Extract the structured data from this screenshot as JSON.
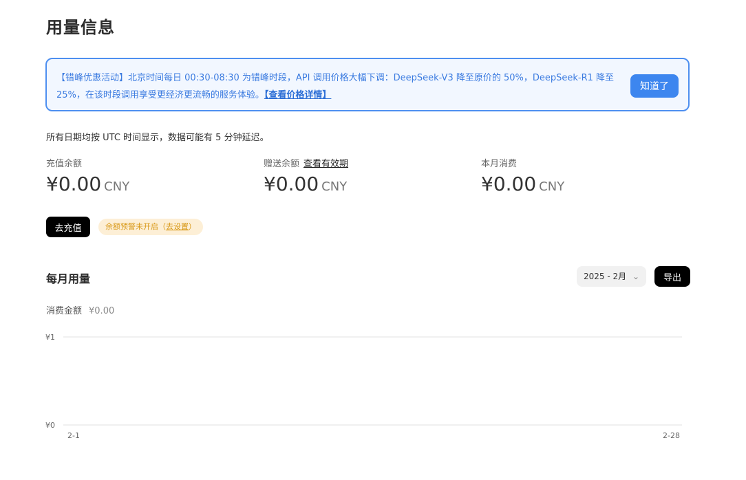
{
  "page": {
    "title": "用量信息"
  },
  "banner": {
    "text": "【错峰优惠活动】北京时间每日 00:30-08:30 为错峰时段，API 调用价格大幅下调：DeepSeek-V3 降至原价的 50%，DeepSeek-R1 降至 25%，在该时段调用享受更经济更流畅的服务体验。",
    "link": "【查看价格详情】",
    "button": "知道了"
  },
  "note": "所有日期均按 UTC 时间显示，数据可能有 5 分钟延迟。",
  "stats": {
    "topup": {
      "label": "充值余额",
      "amount": "¥0.00",
      "unit": "CNY"
    },
    "gift": {
      "label": "赠送余额",
      "link": "查看有效期",
      "amount": "¥0.00",
      "unit": "CNY"
    },
    "month": {
      "label": "本月消费",
      "amount": "¥0.00",
      "unit": "CNY"
    }
  },
  "actions": {
    "recharge": "去充值",
    "alert_prefix": "余额预警未开启（",
    "alert_link": "去设置",
    "alert_suffix": "）"
  },
  "monthly": {
    "title": "每月用量",
    "select_value": "2025 - 2月",
    "export": "导出",
    "spend_label": "消费金额",
    "spend_value": "¥0.00"
  },
  "icons": {
    "select_chevron": "chevron-down-icon"
  },
  "colors": {
    "accent": "#3d86ef",
    "banner_bg": "#f2f7ff",
    "warning": "#d99a1a"
  },
  "chart_data": {
    "type": "line",
    "x_ticks": [
      "2-1",
      "2-28"
    ],
    "y_ticks": [
      "¥0",
      "¥1"
    ],
    "ylim": [
      0,
      1
    ],
    "series": [
      {
        "values": []
      }
    ],
    "grid": true
  }
}
